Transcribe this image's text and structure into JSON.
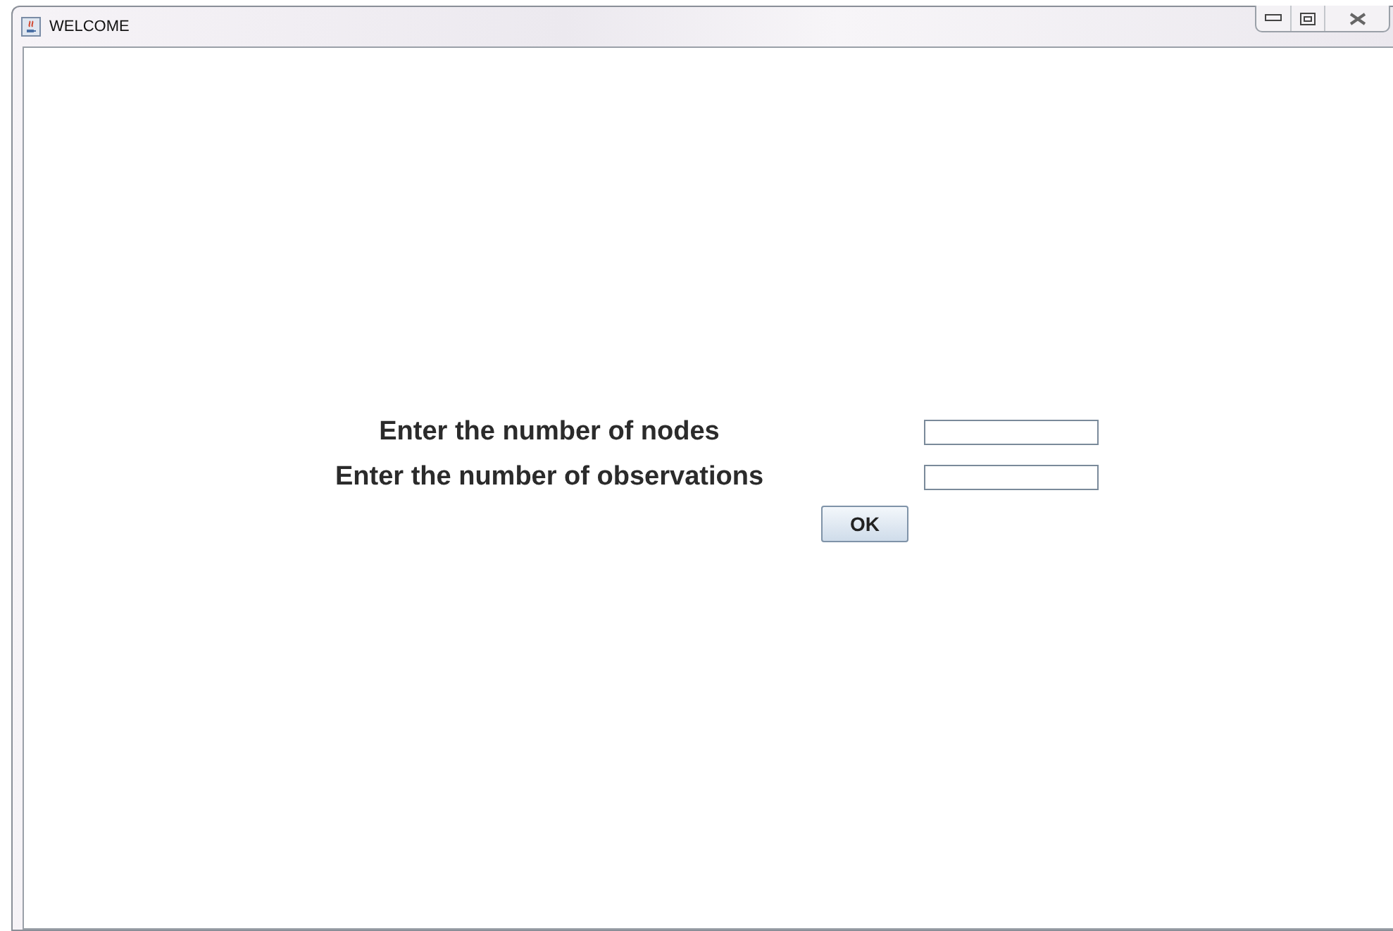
{
  "window": {
    "title": "WELCOME"
  },
  "form": {
    "fields": [
      {
        "label": "Enter the number of nodes"
      },
      {
        "label": "Enter the number of observations"
      }
    ],
    "button": "OK"
  }
}
